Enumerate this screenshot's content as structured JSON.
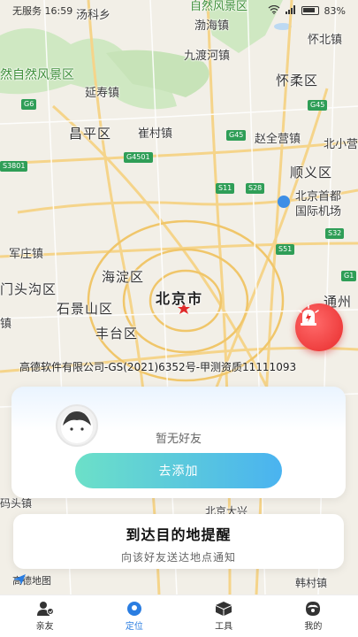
{
  "status_bar": {
    "carrier_time": "无服务 16:59",
    "battery_pct": "83%"
  },
  "map": {
    "labels": {
      "nature_reserve_top": "自然风景区",
      "xiao_tang_shan": "汤科乡",
      "bohai_town": "渤海镇",
      "huaibei_town": "怀北镇",
      "nature_reserve_left": "然自然风景区",
      "jiuduhe_town": "九渡河镇",
      "huairou_district": "怀柔区",
      "yanshou_town": "延寿镇",
      "changping_district": "昌平区",
      "cuicun_town": "崔村镇",
      "zhaoquanying_town": "赵全营镇",
      "beixiaoying": "北小营",
      "shunyi_district": "顺义区",
      "airport": "北京首都\n国际机场",
      "junzhuang_town": "军庄镇",
      "haidian_district": "海淀区",
      "mentougou_district": "门头沟区",
      "shijingshan_district": "石景山区",
      "beijing_city": "北京市",
      "tongzhou": "通州",
      "fengtai_district": "丰台区",
      "hutong": "胡同",
      "town_left": "镇",
      "daxing_airport": "北京大兴",
      "yufa": "码头镇",
      "hancun_town": "韩村镇"
    },
    "roads": {
      "g6": "G6",
      "g45a": "G45",
      "g45b": "G45",
      "g4501": "G4501",
      "s3801": "S3801",
      "s11": "S11",
      "s28": "S28",
      "s51": "S51",
      "s32": "S32",
      "g1": "G1"
    },
    "copyright": "高德软件有限公司-GS(2021)6352号-甲测资质11111093",
    "logo_text": "高德地图"
  },
  "friend_card": {
    "empty_text": "暂无好友",
    "add_button": "去添加"
  },
  "remind_card": {
    "title": "到达目的地提醒",
    "subtitle": "向该好友送达地点通知"
  },
  "tabs": [
    {
      "label": "亲友",
      "icon": "family-icon"
    },
    {
      "label": "定位",
      "icon": "location-icon"
    },
    {
      "label": "工具",
      "icon": "toolbox-icon"
    },
    {
      "label": "我的",
      "icon": "profile-icon"
    }
  ],
  "colors": {
    "accent": "#2a7de1",
    "button_gradient_start": "#6ce0c8",
    "button_gradient_end": "#4ab3f0",
    "alarm_red": "#e82c2c"
  }
}
